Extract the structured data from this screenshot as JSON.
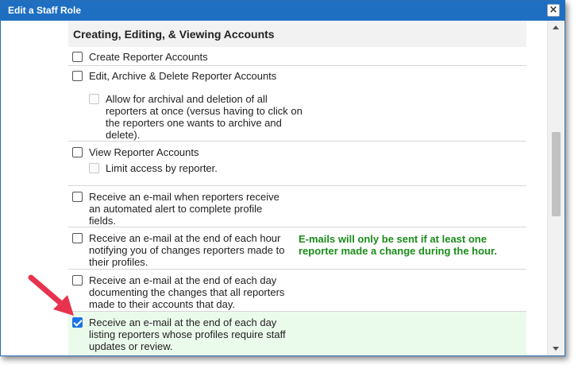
{
  "dialog": {
    "title": "Edit a Staff Role",
    "close_glyph": "×"
  },
  "section": {
    "header": "Creating, Editing, & Viewing Accounts"
  },
  "options": {
    "create": {
      "label": "Create Reporter Accounts",
      "checked": false
    },
    "edit": {
      "label": "Edit, Archive & Delete Reporter Accounts",
      "checked": false
    },
    "edit_sub": {
      "label": "Allow for archival and deletion of all reporters at once (versus having to click on the reporters one wants to archive and delete).",
      "checked": false,
      "disabled": true
    },
    "view": {
      "label": "View Reporter Accounts",
      "checked": false
    },
    "view_sub": {
      "label": "Limit access by reporter.",
      "checked": false,
      "disabled": true
    },
    "email_alert": {
      "label": "Receive an e-mail when reporters receive an automated alert to complete profile fields.",
      "checked": false
    },
    "email_hour": {
      "label": "Receive an e-mail at the end of each hour notifying you of changes reporters made to their profiles.",
      "checked": false
    },
    "email_hour_note": "E-mails will only be sent if at least one reporter made a change during the hour.",
    "email_day": {
      "label": "Receive an e-mail at the end of each day documenting the changes that all reporters made to their accounts that day.",
      "checked": false
    },
    "email_day_review": {
      "label": "Receive an e-mail at the end of each day listing reporters whose profiles require staff updates or review.",
      "checked": true
    }
  },
  "colors": {
    "titlebar": "#1e6fc2",
    "highlight_row": "#ebfbeb",
    "note_text": "#1b8c1b",
    "annotation_arrow": "#e8334f"
  },
  "icons": {
    "close": "close-icon",
    "annotation": "arrow-pointer-icon"
  }
}
